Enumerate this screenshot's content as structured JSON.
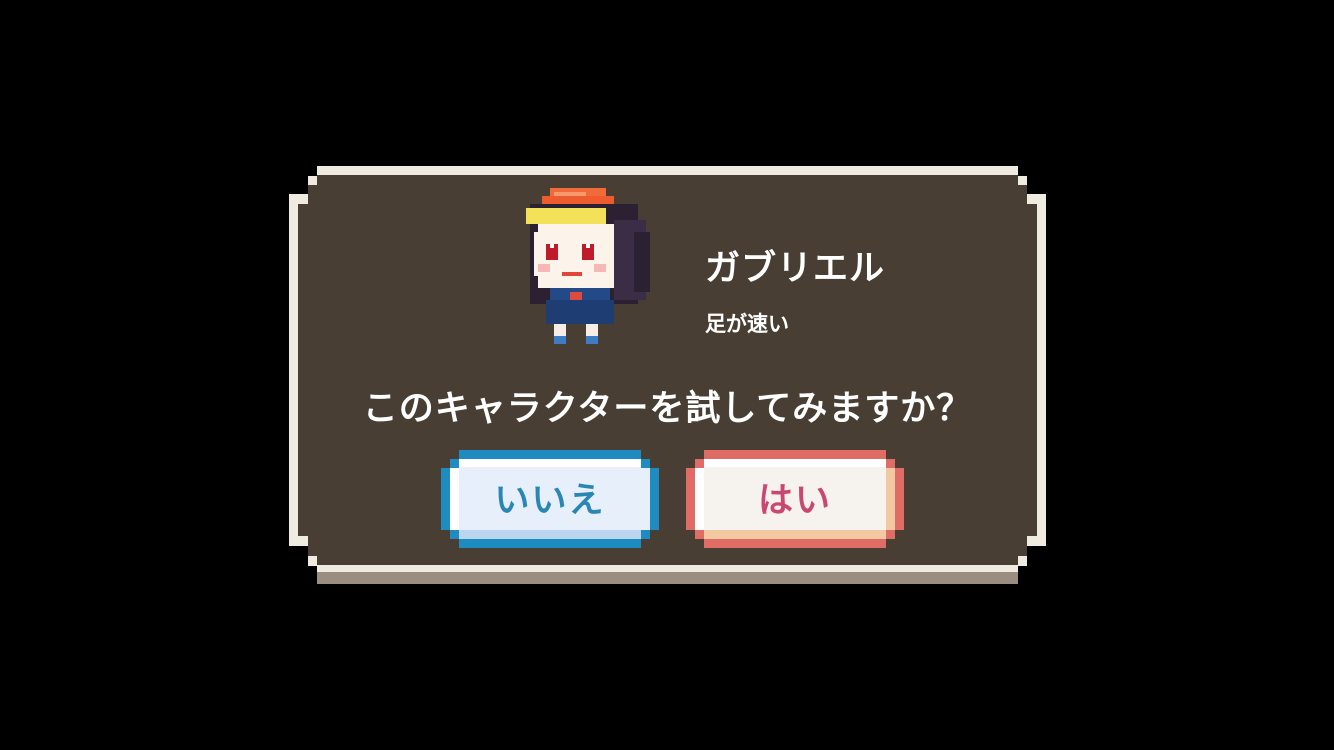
{
  "dialog": {
    "character_name": "ガブリエル",
    "character_trait": "足が速い",
    "question": "このキャラクターを試してみますか？",
    "no_button_label": "いいえ",
    "yes_button_label": "はい"
  },
  "colors": {
    "background": "#000000",
    "panel": "#483e34",
    "panel_border": "#f0ebe1",
    "panel_shadow": "#9a8e80",
    "no_button_border": "#1f8cc1",
    "no_button_fill": "#e7effb",
    "no_button_text": "#2a87b4",
    "yes_button_border": "#df6d66",
    "yes_button_fill": "#f6f2ee",
    "yes_button_text": "#c94771"
  },
  "icons": {
    "portrait": "gabriel-pixel-portrait"
  }
}
